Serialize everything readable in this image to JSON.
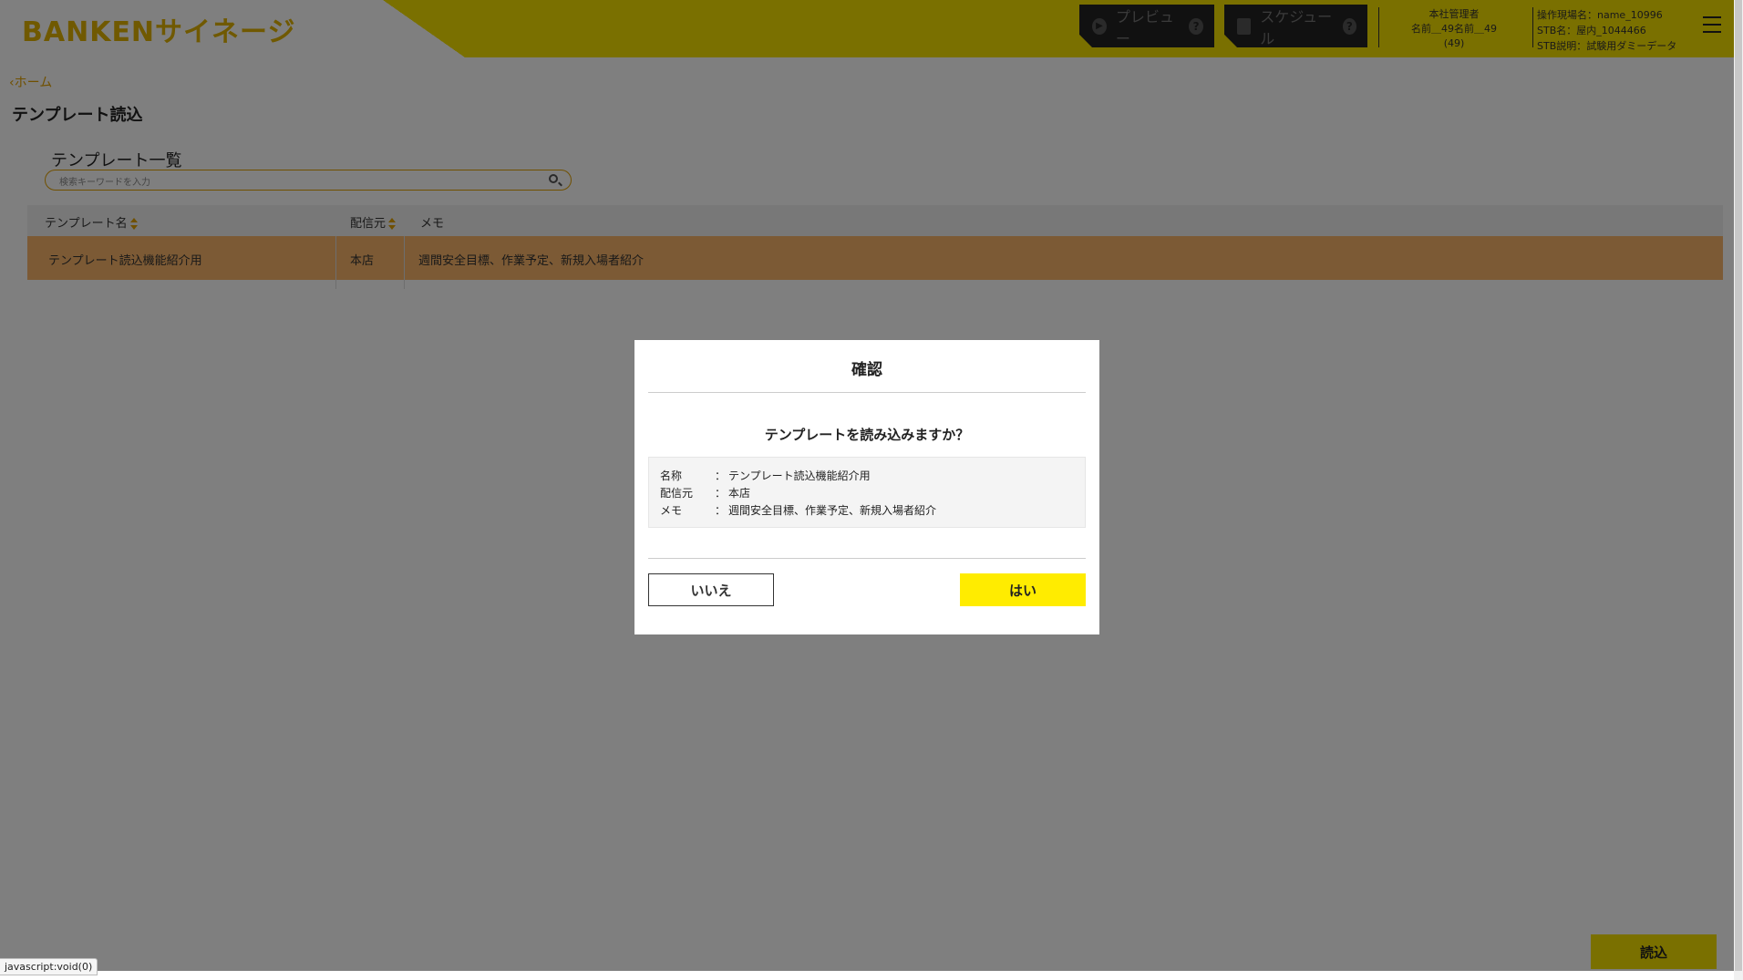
{
  "header": {
    "logo_latin": "BANKEN",
    "logo_kana": "サイネージ",
    "preview_label": "プレビュー",
    "schedule_label": "スケジュール",
    "help_mark": "?",
    "user": {
      "role": "本社管理者",
      "name": "名前＿49名前＿49",
      "id": "(49)"
    },
    "stb": {
      "site": "操作現場名：name_10996",
      "name": "STB名：屋内_1044466",
      "desc": "STB説明：試験用ダミーデータ"
    }
  },
  "nav": {
    "back_label": "ホーム"
  },
  "page": {
    "title": "テンプレート読込",
    "list_title": "テンプレート一覧",
    "search_placeholder": "検索キーワードを入力"
  },
  "table": {
    "headers": [
      "テンプレート名",
      "配信元",
      "メモ"
    ],
    "rows": [
      [
        "テンプレート読込機能紹介用",
        "本店",
        "週間安全目標、作業予定、新規入場者紹介"
      ]
    ]
  },
  "actions": {
    "load_label": "読込"
  },
  "modal": {
    "title": "確認",
    "question": "テンプレートを読み込みますか？",
    "colon": "：",
    "fields": [
      {
        "label": "名称",
        "value": "テンプレート読込機能紹介用"
      },
      {
        "label": "配信元",
        "value": "本店"
      },
      {
        "label": "メモ",
        "value": "週間安全目標、作業予定、新規入場者紹介"
      }
    ],
    "no_label": "いいえ",
    "yes_label": "はい"
  },
  "status_bar": "javascript:void(0)",
  "colors": {
    "accent": "#f5e000",
    "highlight_row": "#f9b46a",
    "link": "#e0a000"
  }
}
